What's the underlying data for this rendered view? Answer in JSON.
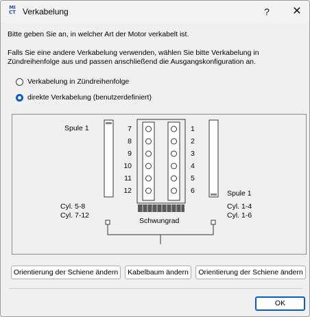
{
  "window": {
    "title": "Verkabelung",
    "help_glyph": "?",
    "close_glyph": "✕",
    "icon_top": "MI",
    "icon_bottom": "CT"
  },
  "intro": "Bitte geben Sie an, in welcher Art der Motor verkabelt ist.",
  "info_line1": "Falls Sie eine andere Verkabelung verwenden, wählen Sie bitte Verkabelung in",
  "info_line2": "Zündreihenfolge aus und passen anschließend die Ausgangskonfiguration an.",
  "options": [
    {
      "label": "Verkabelung in Zündreihenfolge",
      "checked": false
    },
    {
      "label": "direkte Verkabelung (benutzerdefiniert)",
      "checked": true
    }
  ],
  "diagram": {
    "left_coil": "Spule 1",
    "right_coil": "Spule 1",
    "left_numbers": [
      "7",
      "8",
      "9",
      "10",
      "11",
      "12"
    ],
    "right_numbers": [
      "1",
      "2",
      "3",
      "4",
      "5",
      "6"
    ],
    "left_cyl_line1": "Cyl. 5-8",
    "left_cyl_line2": "Cyl. 7-12",
    "right_cyl_line1": "Cyl. 1-4",
    "right_cyl_line2": "Cyl. 1-6",
    "flywheel": "Schwungrad"
  },
  "buttons": {
    "orient_left": "Orientierung der Schiene ändern",
    "harness": "Kabelbaum ändern",
    "orient_right": "Orientierung der Schiene ändern",
    "ok": "OK"
  }
}
